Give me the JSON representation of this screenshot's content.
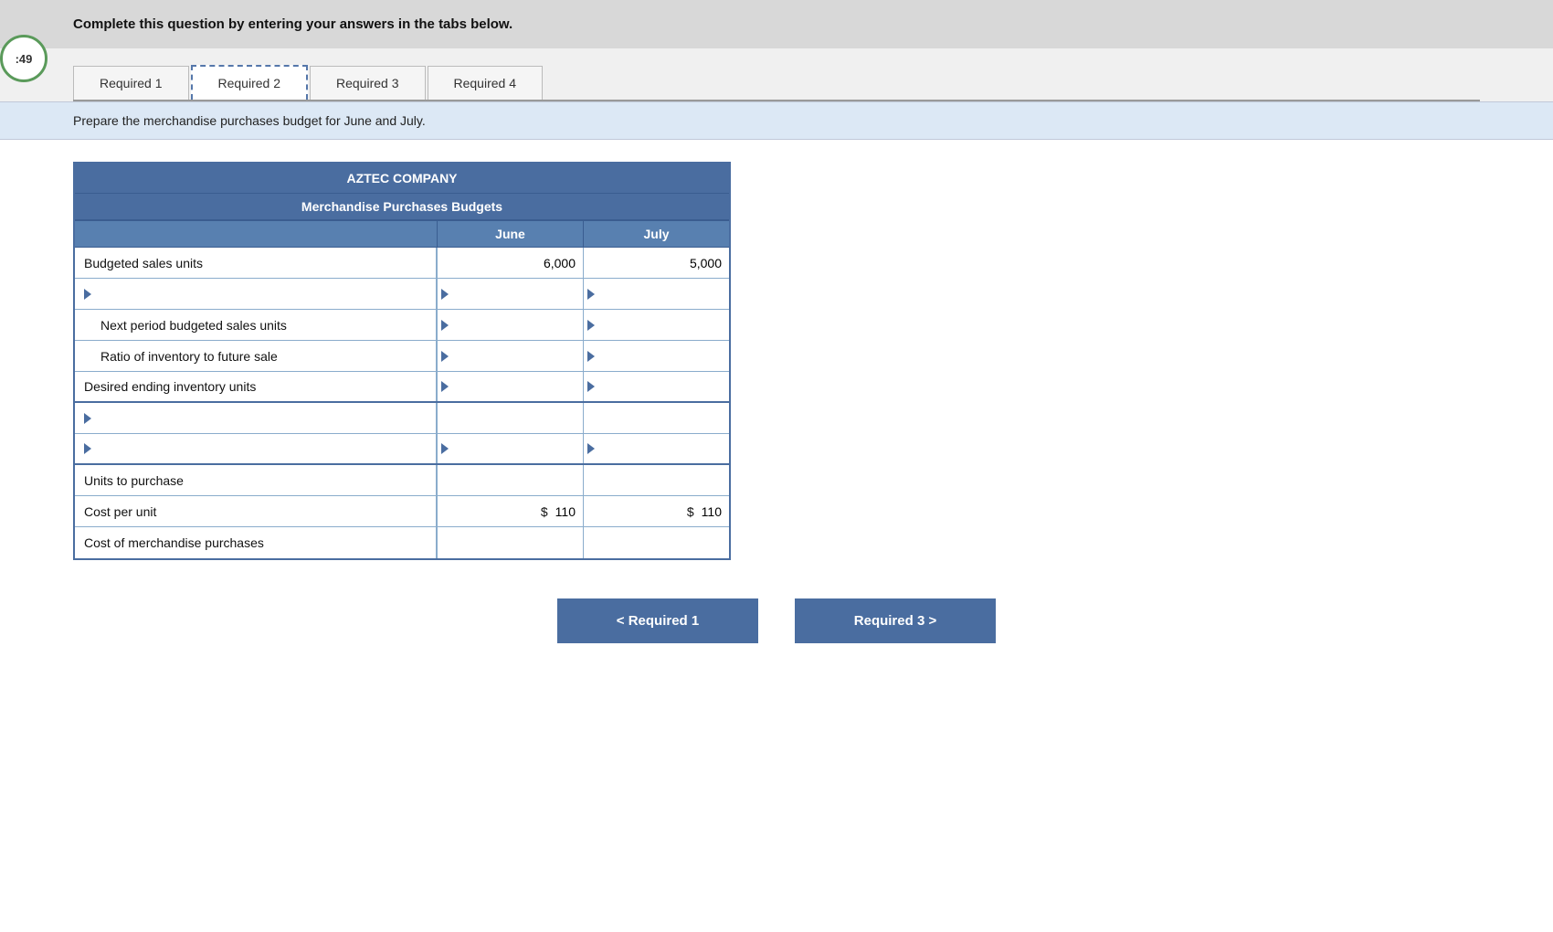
{
  "page": {
    "timer": ":49",
    "instruction": "Complete this question by entering your answers in the tabs below.",
    "sub_instruction": "Prepare the merchandise purchases budget for June and July."
  },
  "tabs": [
    {
      "id": "req1",
      "label": "Required 1",
      "active": false
    },
    {
      "id": "req2",
      "label": "Required 2",
      "active": true
    },
    {
      "id": "req3",
      "label": "Required 3",
      "active": false
    },
    {
      "id": "req4",
      "label": "Required 4",
      "active": false
    }
  ],
  "table": {
    "company": "AZTEC COMPANY",
    "title": "Merchandise Purchases Budgets",
    "col_june": "June",
    "col_july": "July",
    "rows": [
      {
        "id": "row-budgeted-sales",
        "label": "Budgeted sales units",
        "june_val": "6,000",
        "july_val": "5,000",
        "indented": false,
        "input": false
      },
      {
        "id": "row-blank1",
        "label": "",
        "june_val": "",
        "july_val": "",
        "indented": false,
        "input": true,
        "triangle_label": false,
        "triangle_cell": true
      },
      {
        "id": "row-next-period",
        "label": "Next period budgeted sales units",
        "june_val": "",
        "july_val": "",
        "indented": true,
        "input": true,
        "triangle_cell": true
      },
      {
        "id": "row-ratio",
        "label": "Ratio of inventory to future sale",
        "june_val": "",
        "july_val": "",
        "indented": true,
        "input": true,
        "triangle_cell": true
      },
      {
        "id": "row-desired-ending",
        "label": "Desired ending inventory units",
        "june_val": "",
        "july_val": "",
        "indented": false,
        "input": true,
        "triangle_cell": true
      },
      {
        "id": "row-blank2",
        "label": "",
        "june_val": "",
        "july_val": "",
        "indented": false,
        "input": true,
        "triangle_label": true,
        "triangle_cell": false
      },
      {
        "id": "row-blank3",
        "label": "",
        "june_val": "",
        "july_val": "",
        "indented": false,
        "input": true,
        "triangle_label": true,
        "triangle_cell": true
      },
      {
        "id": "row-units-to-purchase",
        "label": "Units to purchase",
        "june_val": "",
        "july_val": "",
        "indented": false,
        "input": true
      },
      {
        "id": "row-cost-per-unit",
        "label": "Cost per unit",
        "june_val": "110",
        "july_val": "110",
        "june_prefix": "$",
        "july_prefix": "$",
        "indented": false,
        "input": false
      },
      {
        "id": "row-cost-merch",
        "label": "Cost of merchandise purchases",
        "june_val": "",
        "july_val": "",
        "indented": false,
        "input": true
      }
    ]
  },
  "buttons": {
    "prev_label": "< Required 1",
    "next_label": "Required 3 >"
  }
}
